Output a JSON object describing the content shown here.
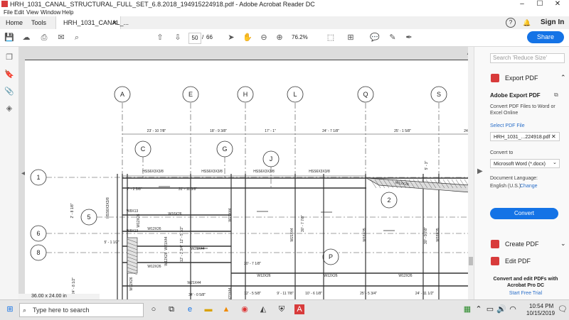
{
  "window": {
    "title": "HRH_1031_CANAL_STRUCTURAL_FULL_SET_6.8.2018_194915224918.pdf - Adobe Acrobat Reader DC",
    "minimize": "–",
    "maximize": "☐",
    "close": "✕"
  },
  "menu": [
    "File",
    "Edit",
    "View",
    "Window",
    "Help"
  ],
  "tabs": {
    "home": "Home",
    "tools": "Tools",
    "document": "HRH_1031_CANAL_...",
    "help": "?",
    "sign_in": "Sign In"
  },
  "toolbar": {
    "page_current": "50",
    "page_separator": "/",
    "page_total": "66",
    "zoom": "76.2%",
    "share": "Share"
  },
  "document": {
    "page_size": "36.00 x 24.00 in",
    "grid_columns": [
      "A",
      "E",
      "H",
      "L",
      "Q",
      "S"
    ],
    "grid_sub_columns": [
      "C",
      "G",
      "J"
    ],
    "grid_rows": [
      "1",
      "5",
      "6",
      "8"
    ],
    "circle_marks": [
      "2",
      "P"
    ],
    "dims_top": [
      "23' - 10 7/8\"",
      "18' - 9 3/8\"",
      "17' - 1\"",
      "24' - 7 1/8\"",
      "25' - 1 5/8\"",
      "24"
    ],
    "beam_labels": [
      "HSS6X3X3/8",
      "HSS6X3X3/8",
      "HSS6X3X3/8",
      "HSS6X3X3/8",
      "W12X26",
      "W16X26",
      "W12X26",
      "W21X44",
      "W12X26",
      "W21X44",
      "W12X26",
      "W12X26",
      "W12X26",
      "W21X44",
      "W8X13",
      "W8X13",
      "HSS6X3X3/8",
      "W12X26",
      "W21X44",
      "W16X35",
      "W21X44",
      "W12X26",
      "W12X26",
      "W21X44",
      "W18X35"
    ],
    "dims_misc": [
      "7' - 2 5/8\"",
      "31' - 11 3/8\"",
      "2' - 8 1/8\"",
      "12' - 5 1/2\"",
      "12' - 2 3/4\"",
      "5' - 1 1/2\"",
      "20' - 7 1/8\"",
      "30' - 7 7/8\"",
      "30' - 9 7/8\"",
      "24' - 8 1/2\"",
      "34' - 0 5/8\"",
      "12' - 5 5/8\"",
      "9' - 11 7/8\"",
      "10' - 6 1/8\"",
      "25' - 5 3/4\"",
      "24' - 11 1/2\"",
      "5' - 3\""
    ]
  },
  "right_panel": {
    "search_placeholder": "Search 'Reduce Size'",
    "export_pdf": "Export PDF",
    "adobe_export_title": "Adobe Export PDF",
    "adobe_export_desc": "Convert PDF Files to Word or Excel Online",
    "select_file_label": "Select PDF File",
    "file_name": "HRH_1031_...224918.pdf",
    "convert_to_label": "Convert to",
    "convert_to_value": "Microsoft Word (*.docx)",
    "doc_language_label": "Document Language:",
    "doc_language_value": "English (U.S.)",
    "change_link": "Change",
    "convert_button": "Convert",
    "create_pdf": "Create PDF",
    "edit_pdf": "Edit PDF",
    "promo": "Convert and edit PDFs with Acrobat Pro DC",
    "free_trial": "Start Free Trial"
  },
  "taskbar": {
    "search_placeholder": "Type here to search",
    "time": "10:54 PM",
    "date": "10/15/2019"
  },
  "colors": {
    "accent": "#1473e6",
    "link": "#2a6fc9",
    "export_icon": "#d83b3b",
    "create_icon": "#d83b3b",
    "edit_icon": "#d83b3b"
  }
}
